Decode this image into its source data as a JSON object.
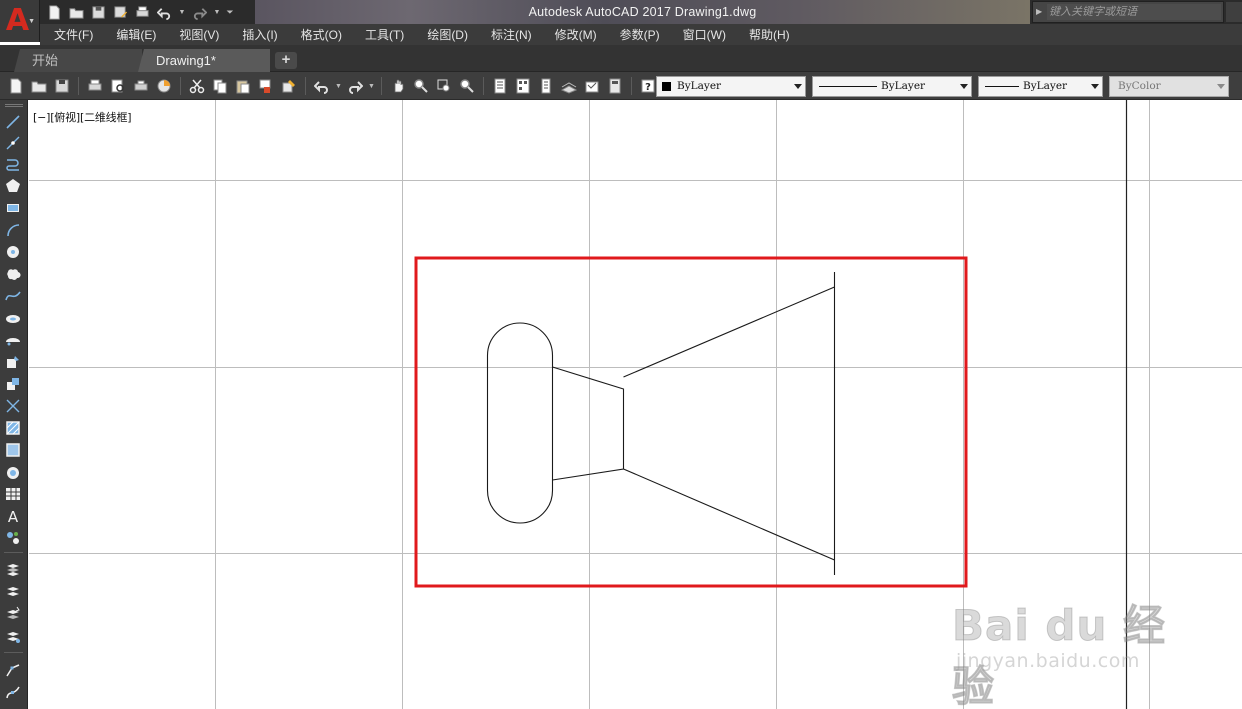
{
  "app": {
    "logo_letter": "A",
    "window_title": "Autodesk AutoCAD 2017    Drawing1.dwg",
    "search_placeholder": "键入关键字或短语"
  },
  "menu": [
    "文件(F)",
    "编辑(E)",
    "视图(V)",
    "插入(I)",
    "格式(O)",
    "工具(T)",
    "绘图(D)",
    "标注(N)",
    "修改(M)",
    "参数(P)",
    "窗口(W)",
    "帮助(H)"
  ],
  "tabs": {
    "start": "开始",
    "drawing": "Drawing1*",
    "new": "+"
  },
  "properties": {
    "color": "ByLayer",
    "linetype": "ByLayer",
    "lineweight": "ByLayer",
    "plotstyle": "ByColor"
  },
  "viewport_label": "[−][俯视][二维线框]",
  "watermark": {
    "brand": "Bai du 经验",
    "url": "jingyan.baidu.com"
  },
  "colors": {
    "highlight_box": "#e0191c",
    "drawing_lines": "#1a1a1a",
    "grid_lines": "#bdbdbd"
  }
}
